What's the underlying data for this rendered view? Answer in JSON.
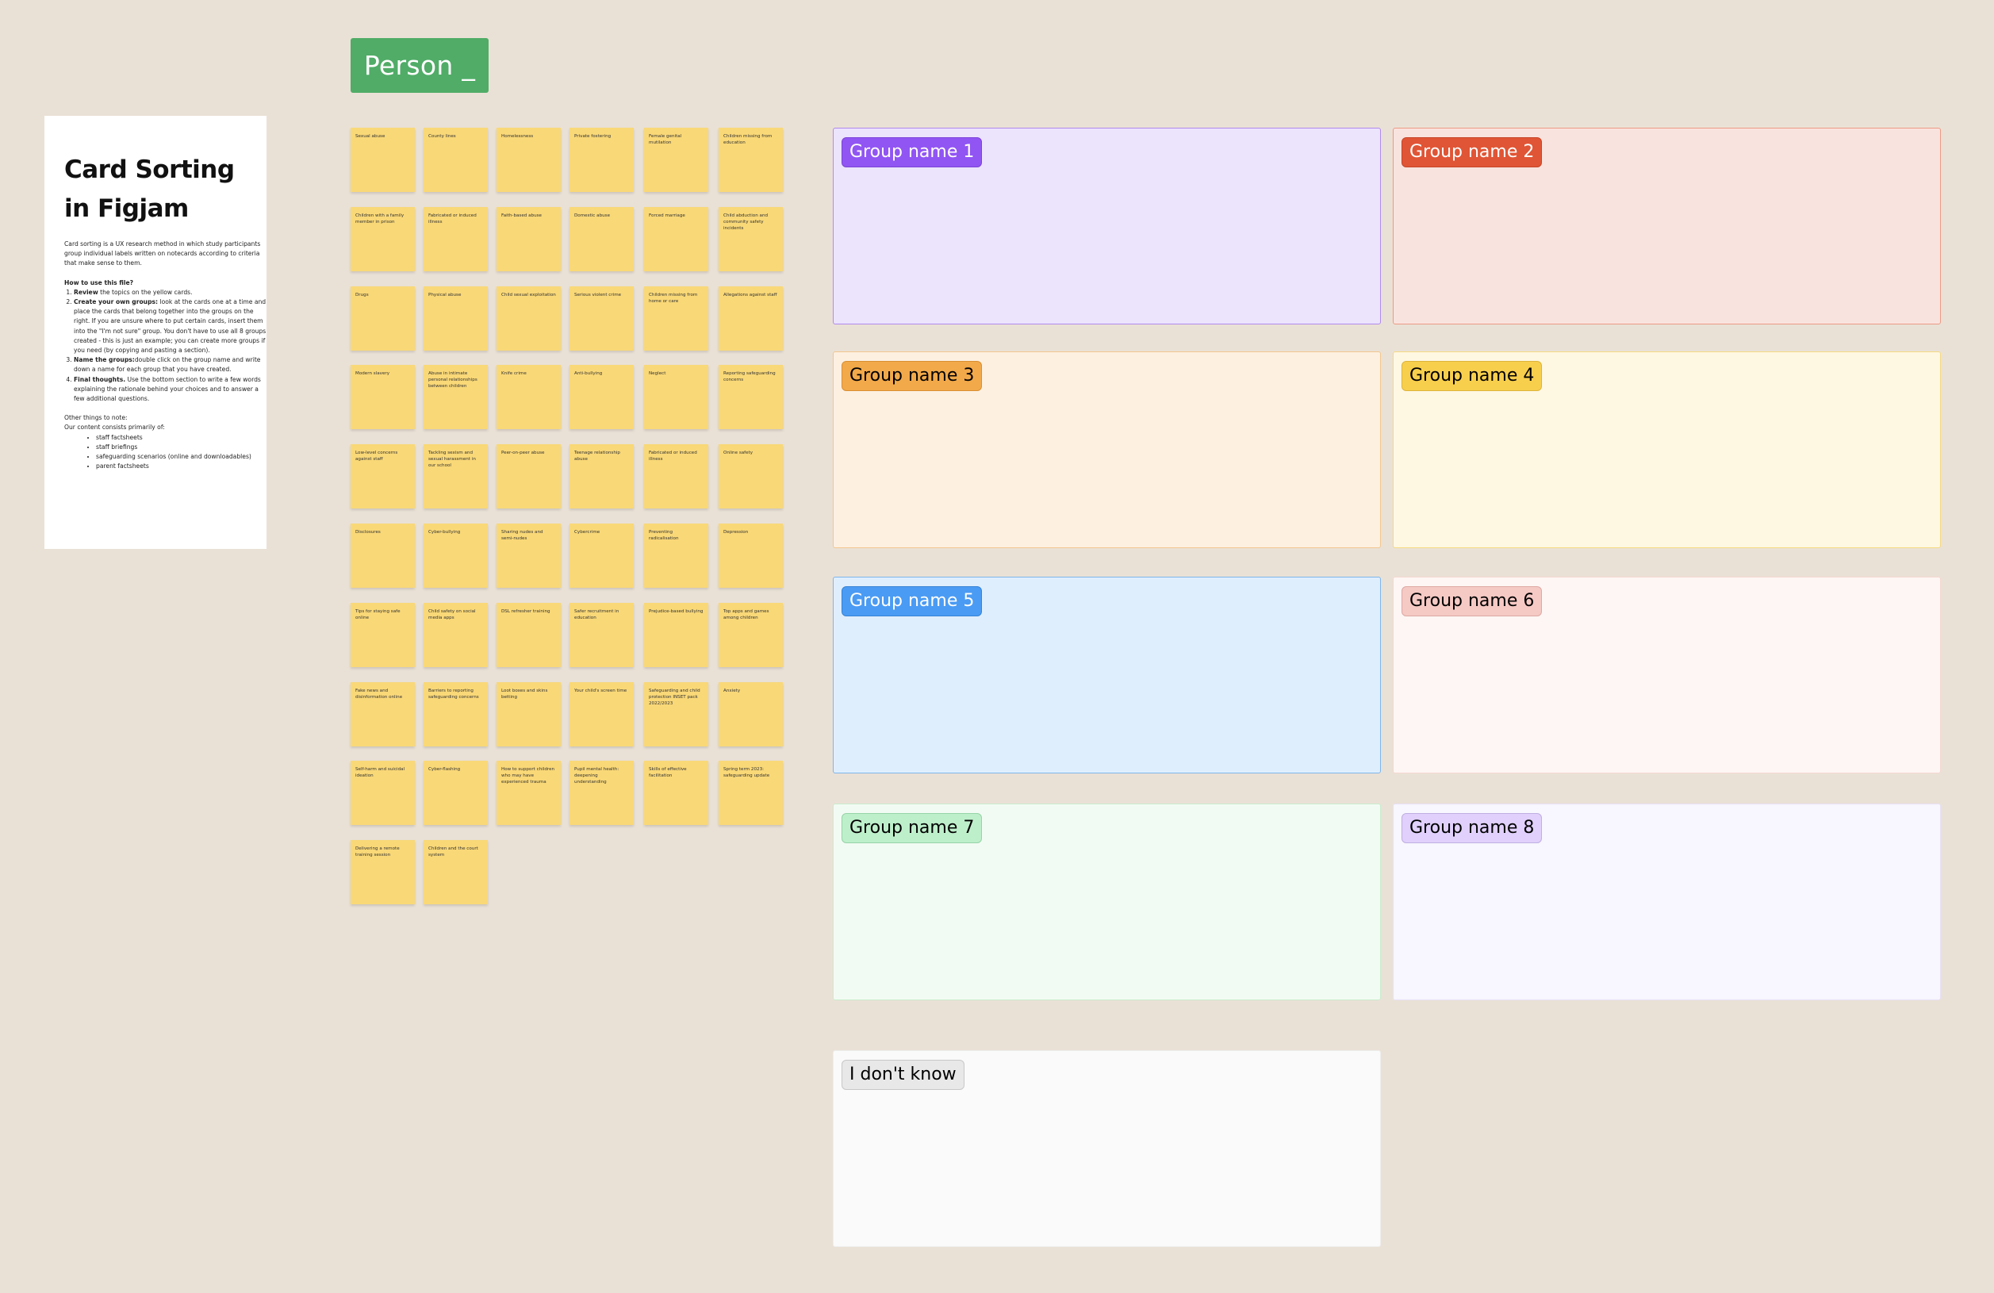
{
  "person_tag": {
    "label": "Person _",
    "color": "#50AC67"
  },
  "instructions": {
    "title": "Card Sorting in Figjam",
    "intro": "Card sorting is a UX research method in which study participants group individual labels written on notecards according to criteria that make sense to them.",
    "how_to_heading": "How to use this file?",
    "steps": [
      {
        "bold": "Review",
        "text": " the topics on the yellow cards."
      },
      {
        "bold": "Create your own groups:",
        "text": " look at the cards one at a time and place the cards that belong together into the groups on the right. If you are unsure where to put certain cards, insert them into the \"I'm not sure\" group. You don't have to use all 8 groups created - this is just an example; you can create more groups if you need (by copying and pasting a section)."
      },
      {
        "bold": "Name the groups:",
        "text": "double click on the group name and write down a name for each group that you have created."
      },
      {
        "bold": "Final thoughts.",
        "text": " Use the bottom section to write a few words explaining the rationale behind your choices and to answer a few additional questions."
      }
    ],
    "other_heading": "Other things to note:",
    "content_intro": "Our content consists primarily of:",
    "content_items": [
      "staff factsheets",
      "staff briefings",
      "safeguarding scenarios (online and downloadables)",
      "parent factsheets"
    ]
  },
  "cards": [
    "Sexual abuse",
    "County lines",
    "Homelessness",
    "Private fostering",
    "Female genital mutilation",
    "Children missing from education",
    "Children with a family member in prison",
    "Fabricated or induced illness",
    "Faith-based abuse",
    "Domestic abuse",
    "Forced marriage",
    "Child abduction and community safety incidents",
    "Drugs",
    "Physical abuse",
    "Child sexual exploitation",
    "Serious violent crime",
    "Children missing from home or care",
    "Allegations against staff",
    "Modern slavery",
    "Abuse in intimate personal relationships between children",
    "Knife crime",
    "Anti-bullying",
    "Neglect",
    "Reporting safeguarding concerns",
    "Low-level concerns against staff",
    "Tackling sexism and sexual harassment in our school",
    "Peer-on-peer abuse",
    "Teenage relationship abuse",
    "Fabricated or induced illness",
    "Online safety",
    "Disclosures",
    "Cyber-bullying",
    "Sharing nudes and semi-nudes",
    "Cybercrime",
    "Preventing radicalisation",
    "Depression",
    "Tips for staying safe online",
    "Child safety on social media apps",
    "DSL refresher training",
    "Safer recruitment in education",
    "Prejudice-based bullying",
    "Top apps and games among children",
    "Fake news and disinformation online",
    "Barriers to reporting safeguarding concerns",
    "Loot boxes and skins betting",
    "Your child's screen time",
    "Safeguarding and child protection INSET pack 2022/2023",
    "Anxiety",
    "Self-harm and suicidal ideation",
    "Cyber-flashing",
    "How to support children who may have experienced trauma",
    "Pupil mental health: deepening understanding",
    "Skills of effective facilitation",
    "Spring term 2023: safeguarding update",
    "Delivering a remote training session",
    "Children and the court system"
  ],
  "card_color": "#F9D877",
  "groups": [
    {
      "label": "Group name 1",
      "bg": "#ECE3FD",
      "border": "#B08AEE",
      "tag_bg": "#9155F3",
      "tag_border": "#7B43D6",
      "tag_text": "#FFFFFF"
    },
    {
      "label": "Group name 2",
      "bg": "#F9E3DE",
      "border": "#EC9A85",
      "tag_bg": "#E05535",
      "tag_border": "#C54427",
      "tag_text": "#FFFFFF"
    },
    {
      "label": "Group name 3",
      "bg": "#FDF0E1",
      "border": "#F2C68F",
      "tag_bg": "#F2A94A",
      "tag_border": "#D98F33",
      "tag_text": "#000000"
    },
    {
      "label": "Group name 4",
      "bg": "#FEF7E2",
      "border": "#F5D981",
      "tag_bg": "#F8CF4D",
      "tag_border": "#DDB43A",
      "tag_text": "#000000"
    },
    {
      "label": "Group name 5",
      "bg": "#DFEEFD",
      "border": "#7DB5EC",
      "tag_bg": "#4A9BF3",
      "tag_border": "#3683D6",
      "tag_text": "#FFFFFF"
    },
    {
      "label": "Group name 6",
      "bg": "#FDF6F4",
      "border": "#F5D7D0",
      "tag_bg": "#F5C9C4",
      "tag_border": "#DEA9A3",
      "tag_text": "#000000"
    },
    {
      "label": "Group name 7",
      "bg": "#F2FBF3",
      "border": "#C8EDCC",
      "tag_bg": "#BEEFCB",
      "tag_border": "#96D3A7",
      "tag_text": "#000000"
    },
    {
      "label": "Group name 8",
      "bg": "#F8F6FE",
      "border": "#E6E0F7",
      "tag_bg": "#E0D0FB",
      "tag_border": "#BFAEE2",
      "tag_text": "#000000"
    },
    {
      "label": "I don't know",
      "bg": "#FAFAFA",
      "border": "#EEEEEE",
      "tag_bg": "#E8E8E8",
      "tag_border": "#C8C8C8",
      "tag_text": "#000000"
    }
  ]
}
